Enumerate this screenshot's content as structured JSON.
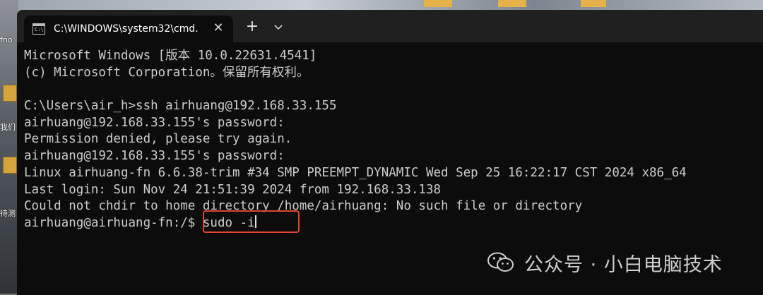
{
  "desktop": {
    "labels": [
      "fno",
      "我们",
      "待测"
    ]
  },
  "tab": {
    "icon_text": "C:\\",
    "title": "C:\\WINDOWS\\system32\\cmd.",
    "close_glyph": "✕"
  },
  "titlebar": {
    "new_tab_glyph": "+"
  },
  "terminal": {
    "lines": [
      "Microsoft Windows [版本 10.0.22631.4541]",
      "(c) Microsoft Corporation。保留所有权利。",
      "",
      "C:\\Users\\air_h>ssh airhuang@192.168.33.155",
      "airhuang@192.168.33.155's password:",
      "Permission denied, please try again.",
      "airhuang@192.168.33.155's password:",
      "Linux airhuang-fn 6.6.38-trim #34 SMP PREEMPT_DYNAMIC Wed Sep 25 16:22:17 CST 2024 x86_64",
      "Last login: Sun Nov 24 21:51:39 2024 from 192.168.33.138",
      "Could not chdir to home directory /home/airhuang: No such file or directory"
    ],
    "prompt": "airhuang@airhuang-fn:/$ ",
    "command": "sudo -i"
  },
  "watermark": {
    "text": "公众号 · 小白电脑技术"
  },
  "colors": {
    "highlight": "#e0452c",
    "terminal_bg": "#0c0c0c",
    "text": "#cccccc"
  }
}
